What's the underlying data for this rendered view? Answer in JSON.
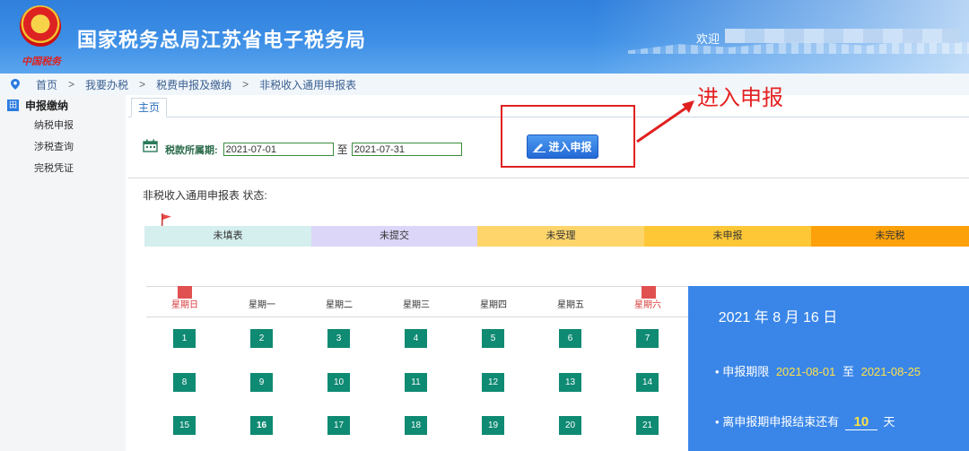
{
  "header": {
    "emblem_tag": "中国税务",
    "title": "国家税务总局江苏省电子税务局",
    "welcome": "欢迎"
  },
  "breadcrumb": [
    "首页",
    "我要办税",
    "税费申报及缴纳",
    "非税收入通用申报表"
  ],
  "sidebar": {
    "section": "申报缴纳",
    "items": [
      {
        "label": "纳税申报"
      },
      {
        "label": "涉税查询"
      },
      {
        "label": "完税凭证"
      }
    ]
  },
  "tabs": [
    {
      "label": "主页"
    }
  ],
  "period": {
    "label": "税款所属期:",
    "start": "2021-07-01",
    "to": "至",
    "end": "2021-07-31"
  },
  "enter_button": {
    "label": "进入申报",
    "icon": "edit-icon"
  },
  "annotation": {
    "label": "进入申报",
    "color": "#e52222"
  },
  "status": {
    "title": "非税收入通用申报表 状态:",
    "steps": [
      {
        "label": "未填表",
        "color": "#d5eeee"
      },
      {
        "label": "未提交",
        "color": "#dcd6f8"
      },
      {
        "label": "未受理",
        "color": "#fdd56b"
      },
      {
        "label": "未申报",
        "color": "#fdc736"
      },
      {
        "label": "未完税",
        "color": "#fca10a"
      }
    ]
  },
  "calendar": {
    "weekdays": [
      "星期日",
      "星期一",
      "星期二",
      "星期三",
      "星期四",
      "星期五",
      "星期六"
    ],
    "days": [
      1,
      2,
      3,
      4,
      5,
      6,
      7,
      8,
      9,
      10,
      11,
      12,
      13,
      14,
      15,
      16,
      17,
      18,
      19,
      20,
      21
    ],
    "today": 16
  },
  "info": {
    "date": "2021 年 8 月 16 日",
    "deadline_label": "申报期限",
    "deadline_start": "2021-08-01",
    "deadline_to": "至",
    "deadline_end": "2021-08-25",
    "remaining_prefix": "离申报期申报结束还有",
    "remaining_days": "10",
    "remaining_suffix": "天"
  },
  "colors": {
    "header_blue": "#2f7fdc",
    "button_blue": "#2369d6",
    "calendar_green": "#0f8a73",
    "info_panel": "#3a86e8",
    "highlight_yellow": "#ffe14a"
  }
}
